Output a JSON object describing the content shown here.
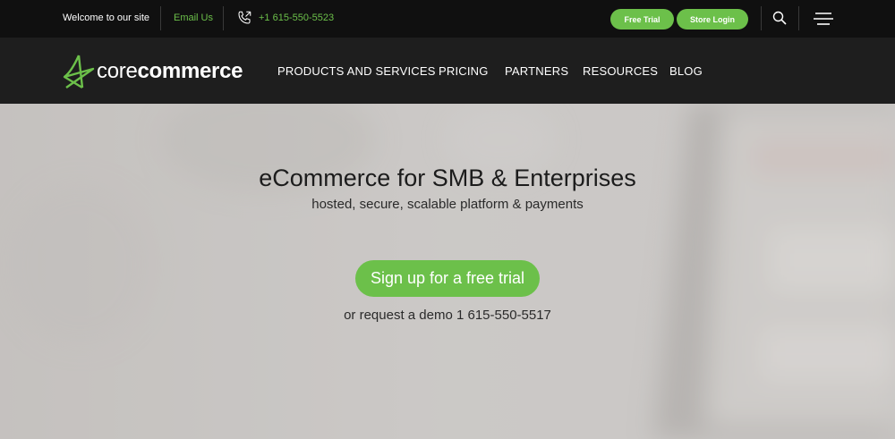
{
  "topbar": {
    "welcome": "Welcome to our site",
    "email_label": "Email Us",
    "phone": "+1 615-550-5523",
    "free_trial_label": "Free Trial",
    "store_login_label": "Store Login"
  },
  "nav": {
    "logo_light": "core",
    "logo_bold": "commerce",
    "items": [
      {
        "label": "PRODUCTS AND SERVICES"
      },
      {
        "label": "PRICING"
      },
      {
        "label": "PARTNERS"
      },
      {
        "label": "RESOURCES"
      },
      {
        "label": "BLOG"
      }
    ]
  },
  "hero": {
    "title": "eCommerce for SMB & Enterprises",
    "subtitle": "hosted, secure, scalable platform & payments",
    "cta_label": "Sign up for a free trial",
    "demo_text": "or request a demo 1 615-550-5517"
  },
  "colors": {
    "accent": "#6cc04a",
    "topbar_bg": "#101010",
    "navbar_bg": "#1e1e1e",
    "hero_bg": "#c9c6c4"
  },
  "icons": [
    "phone-icon",
    "search-icon",
    "menu-icon",
    "logo-star-icon"
  ]
}
